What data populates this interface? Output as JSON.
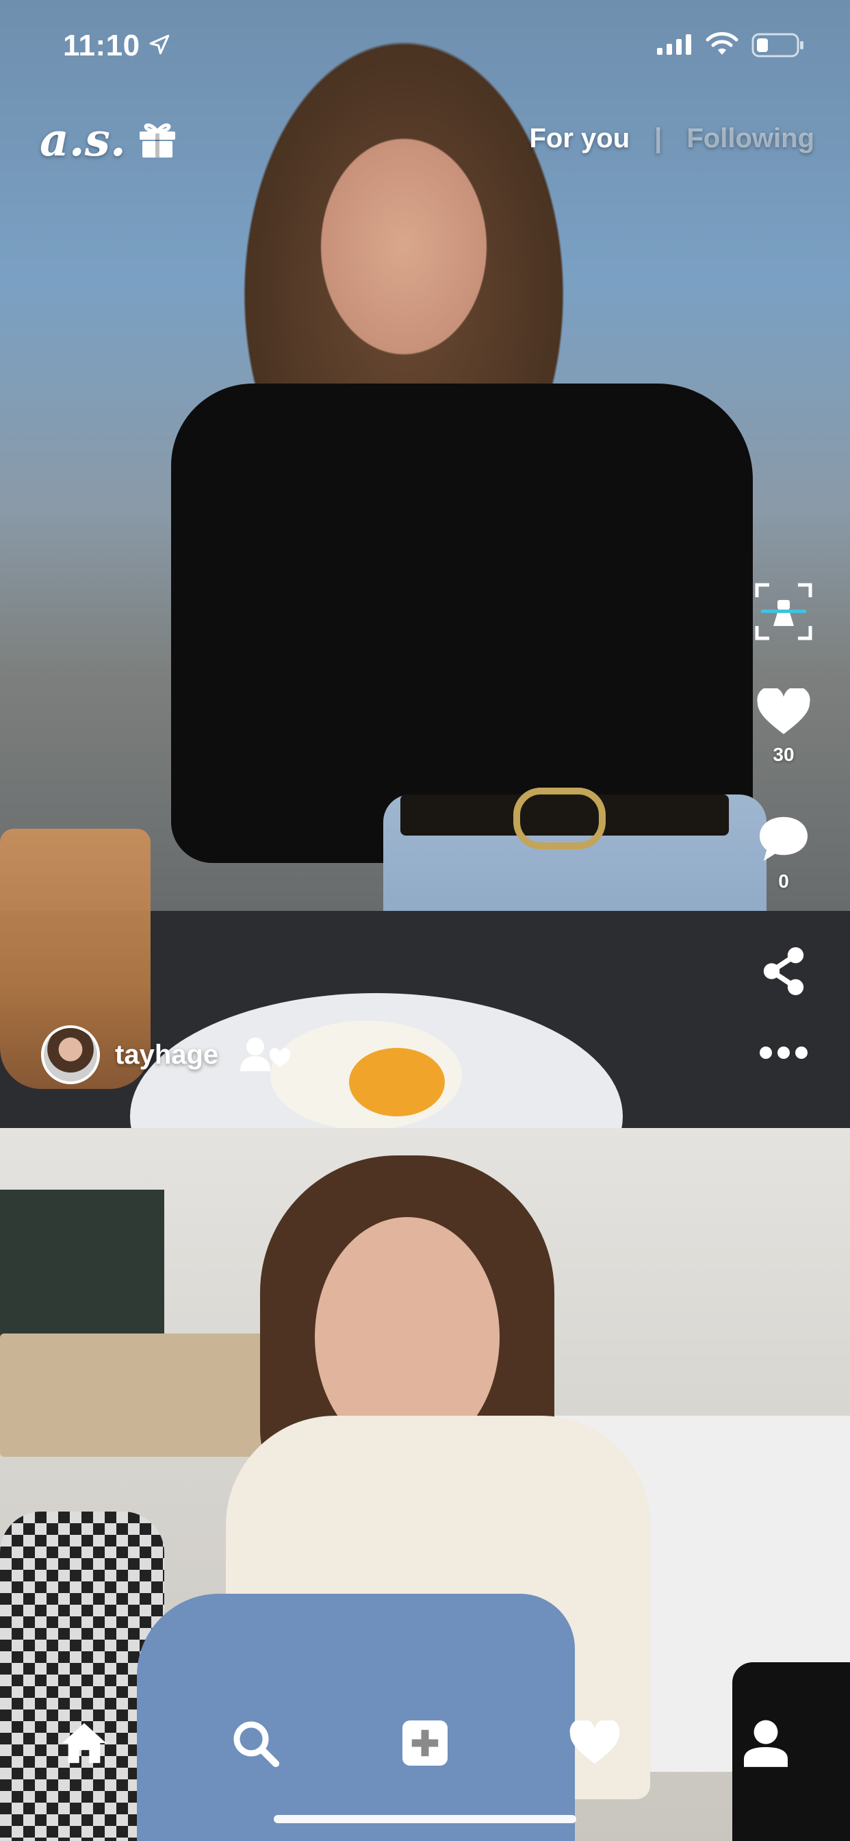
{
  "status_bar": {
    "time": "11:10"
  },
  "header": {
    "logo": "a.s.",
    "tabs": [
      {
        "label": "For you",
        "active": true
      },
      {
        "label": "Following",
        "active": false
      }
    ],
    "separator": "|"
  },
  "post": {
    "username": "tayhage",
    "likes": "30",
    "comments": "0"
  },
  "icons": {
    "location": "location-arrow-icon",
    "gift": "gift-icon",
    "scan": "outfit-scan-icon",
    "like": "heart-icon",
    "comment": "comment-bubble-icon",
    "share": "share-icon",
    "more": "more-dots-icon",
    "follow": "follow-user-icon",
    "nav": [
      "home-icon",
      "search-icon",
      "add-post-icon",
      "heart-icon",
      "profile-icon"
    ]
  },
  "colors": {
    "foreground": "#ffffff",
    "inactive_tab": "rgba(255,255,255,0.45)"
  }
}
